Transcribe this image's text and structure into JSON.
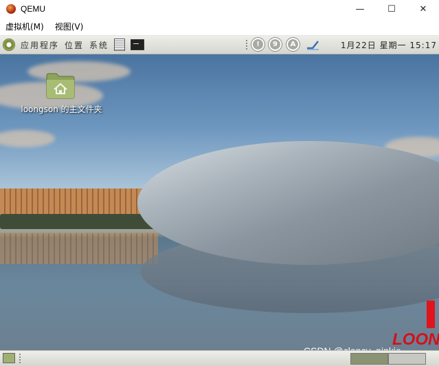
{
  "window": {
    "title": "QEMU",
    "min_glyph": "—",
    "max_glyph": "☐",
    "close_glyph": "✕"
  },
  "menubar": {
    "items": [
      "虚拟机(M)",
      "视图(V)"
    ]
  },
  "panel": {
    "menus": [
      "应用程序",
      "位置",
      "系统"
    ],
    "tray": [
      "!",
      "9",
      "A"
    ],
    "clock": "1月22日 星期一 15:17"
  },
  "desktop": {
    "icon_label": "loongson 的主文件夹",
    "logo_text": "LOON"
  },
  "watermark": "CSDN @clancy_pinkie",
  "colors": {
    "panel": "#e2e2de",
    "folder": "#8da35a",
    "brand_red": "#e0141c"
  }
}
